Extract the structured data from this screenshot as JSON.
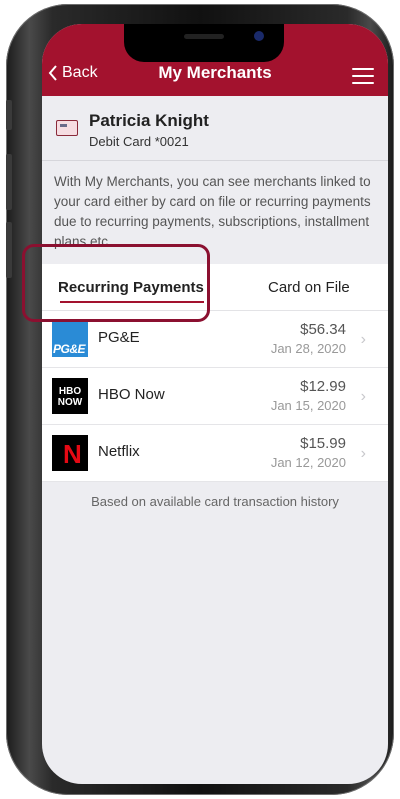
{
  "nav": {
    "back_label": "Back",
    "title": "My Merchants"
  },
  "user": {
    "name": "Patricia Knight",
    "card": "Debit Card *0021"
  },
  "description": "With My Merchants, you can see merchants linked to your card either by card on file or recurring payments due to recurring payments, subscriptions, installment plans etc.",
  "tabs": [
    {
      "label": "Recurring Payments",
      "active": true
    },
    {
      "label": "Card on File",
      "active": false
    }
  ],
  "merchants": [
    {
      "name": "PG&E",
      "amount": "$56.34",
      "date": "Jan 28, 2020",
      "logo_text": "PG&E"
    },
    {
      "name": "HBO Now",
      "amount": "$12.99",
      "date": "Jan 15, 2020",
      "logo_text": "HBO NOW"
    },
    {
      "name": "Netflix",
      "amount": "$15.99",
      "date": "Jan 12, 2020",
      "logo_text": "N"
    }
  ],
  "footer_note": "Based on available card transaction history",
  "colors": {
    "brand": "#a3122e",
    "highlight": "#8b1030",
    "background": "#ededf1"
  }
}
